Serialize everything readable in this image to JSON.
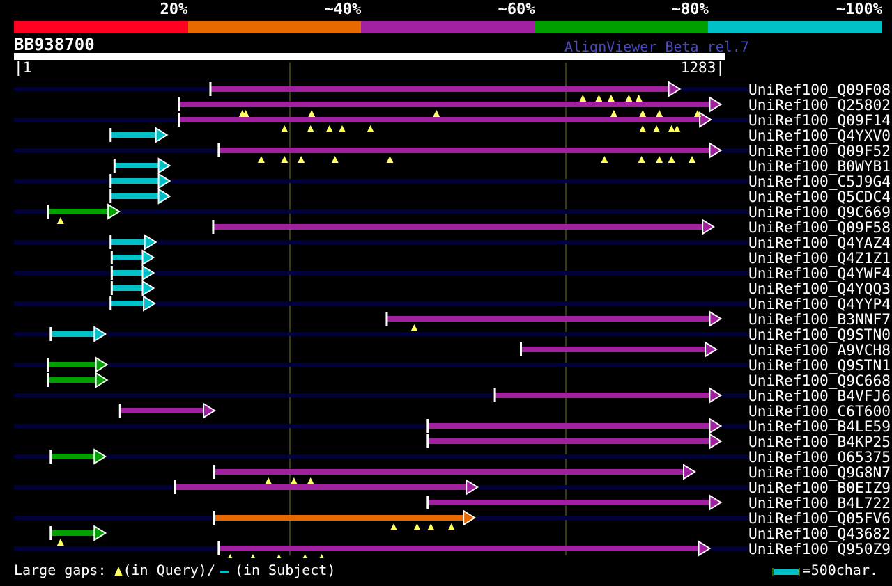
{
  "score_legend": [
    {
      "label": "20%",
      "color": "#ff0020"
    },
    {
      "label": "~40%",
      "color": "#e86800"
    },
    {
      "label": "~60%",
      "color": "#a020a0"
    },
    {
      "label": "~80%",
      "color": "#00a000"
    },
    {
      "label": "~100%",
      "color": "#00c0c8"
    }
  ],
  "alignment_view": {
    "query_name": "BB938700",
    "version": "AlignViewer Beta rel.7",
    "scale_start": "|1",
    "scale_end": "1283|",
    "alignments": [
      {
        "label": "UniRef100_Q09F08",
        "color": "#a020a0"
      },
      {
        "label": "UniRef100_Q25802",
        "color": "#a020a0"
      },
      {
        "label": "UniRef100_Q09F14",
        "color": "#a020a0"
      },
      {
        "label": "UniRef100_Q4YXV0",
        "color": "#00c0c8"
      },
      {
        "label": "UniRef100_Q09F52",
        "color": "#a020a0"
      },
      {
        "label": "UniRef100_B0WYB1",
        "color": "#00c0c8"
      },
      {
        "label": "UniRef100_C5J9G4",
        "color": "#00c0c8"
      },
      {
        "label": "UniRef100_Q5CDC4",
        "color": "#00c0c8"
      },
      {
        "label": "UniRef100_Q9C669",
        "color": "#00a000"
      },
      {
        "label": "UniRef100_Q09F58",
        "color": "#a020a0"
      },
      {
        "label": "UniRef100_Q4YAZ4",
        "color": "#00c0c8"
      },
      {
        "label": "UniRef100_Q4Z1Z1",
        "color": "#00c0c8"
      },
      {
        "label": "UniRef100_Q4YWF4",
        "color": "#00c0c8"
      },
      {
        "label": "UniRef100_Q4YQQ3",
        "color": "#00c0c8"
      },
      {
        "label": "UniRef100_Q4YYP4",
        "color": "#00c0c8"
      },
      {
        "label": "UniRef100_B3NNF7",
        "color": "#a020a0"
      },
      {
        "label": "UniRef100_Q9STN0",
        "color": "#00c0c8"
      },
      {
        "label": "UniRef100_A9VCH8",
        "color": "#a020a0"
      },
      {
        "label": "UniRef100_Q9STN1",
        "color": "#00a000"
      },
      {
        "label": "UniRef100_Q9C668",
        "color": "#00a000"
      },
      {
        "label": "UniRef100_B4VFJ6",
        "color": "#a020a0"
      },
      {
        "label": "UniRef100_C6T600",
        "color": "#a020a0"
      },
      {
        "label": "UniRef100_B4LE59",
        "color": "#a020a0"
      },
      {
        "label": "UniRef100_B4KP25",
        "color": "#a020a0"
      },
      {
        "label": "UniRef100_O65375",
        "color": "#00a000"
      },
      {
        "label": "UniRef100_Q9G8N7",
        "color": "#a020a0"
      },
      {
        "label": "UniRef100_B0EIZ9",
        "color": "#a020a0"
      },
      {
        "label": "UniRef100_B4L722",
        "color": "#a020a0"
      },
      {
        "label": "UniRef100_Q05FV6",
        "color": "#e86800"
      },
      {
        "label": "UniRef100_Q43682",
        "color": "#00a000"
      },
      {
        "label": "UniRef100_Q950Z9",
        "color": "#a020a0"
      }
    ]
  },
  "gap_legend": {
    "label": "Large gaps:",
    "query": "(in Query)/",
    "subject": "(in Subject)"
  },
  "scale_legend": {
    "label": "=500char."
  }
}
